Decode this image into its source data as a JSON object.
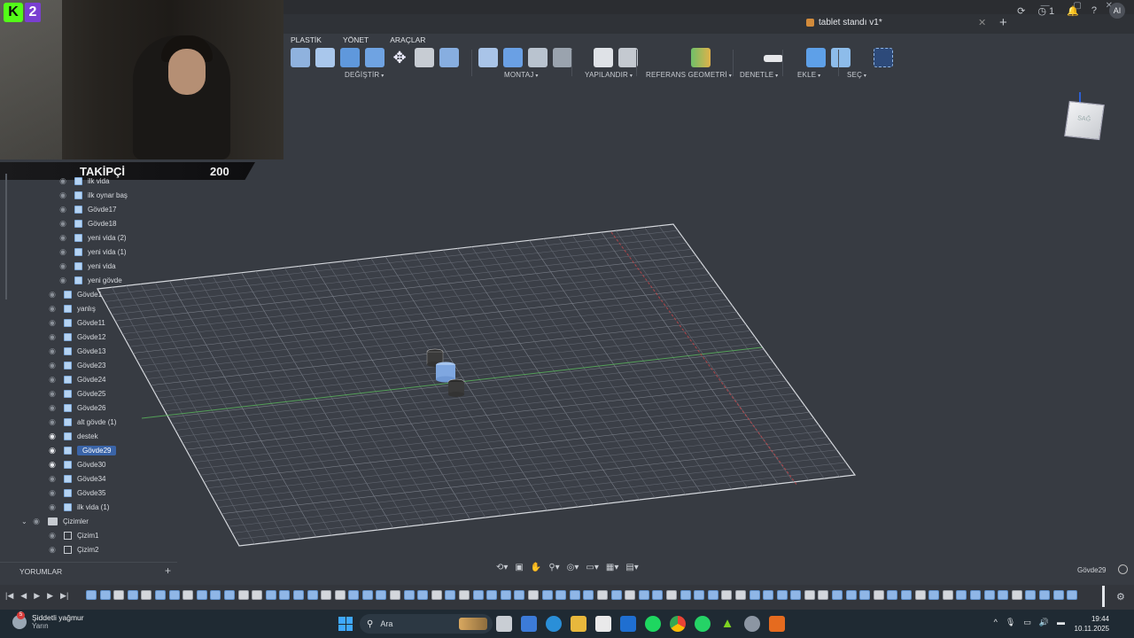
{
  "window": {
    "document_tab": "tablet standı v1*",
    "top_icons": [
      "+",
      "⟳",
      "⌚ 1",
      "🔔",
      "?",
      "AI"
    ]
  },
  "toolbar": {
    "tabs": [
      "PLASTİK",
      "YÖNET",
      "ARAÇLAR"
    ],
    "groups": {
      "modify": "DEĞİŞTİR",
      "assembly": "MONTAJ",
      "configure": "YAPILANDIR",
      "reference_geometry": "REFERANS GEOMETRİ",
      "inspect": "DENETLE",
      "insert": "EKLE",
      "select": "SEÇ"
    }
  },
  "stream": {
    "kick_number": "2",
    "followers_label": "TAKİPÇİ",
    "followers_count": "200"
  },
  "viewcube": {
    "face_label": "SAĞ"
  },
  "browser": {
    "items": [
      {
        "label": "ilk vida",
        "indent": 2,
        "visible": false,
        "kind": "body"
      },
      {
        "label": "ilk oynar baş",
        "indent": 2,
        "visible": false,
        "kind": "body"
      },
      {
        "label": "Gövde17",
        "indent": 2,
        "visible": false,
        "kind": "body"
      },
      {
        "label": "Gövde18",
        "indent": 2,
        "visible": false,
        "kind": "body"
      },
      {
        "label": "yeni vida (2)",
        "indent": 2,
        "visible": false,
        "kind": "body"
      },
      {
        "label": "yeni vida (1)",
        "indent": 2,
        "visible": false,
        "kind": "body"
      },
      {
        "label": "yeni vida",
        "indent": 2,
        "visible": false,
        "kind": "body"
      },
      {
        "label": "yeni gövde",
        "indent": 2,
        "visible": false,
        "kind": "body"
      },
      {
        "label": "Gövde1",
        "indent": 1,
        "visible": false,
        "kind": "body"
      },
      {
        "label": "yanlış",
        "indent": 1,
        "visible": false,
        "kind": "body"
      },
      {
        "label": "Gövde11",
        "indent": 1,
        "visible": false,
        "kind": "body"
      },
      {
        "label": "Gövde12",
        "indent": 1,
        "visible": false,
        "kind": "body"
      },
      {
        "label": "Gövde13",
        "indent": 1,
        "visible": false,
        "kind": "body"
      },
      {
        "label": "Gövde23",
        "indent": 1,
        "visible": false,
        "kind": "body"
      },
      {
        "label": "Gövde24",
        "indent": 1,
        "visible": false,
        "kind": "body"
      },
      {
        "label": "Gövde25",
        "indent": 1,
        "visible": false,
        "kind": "body"
      },
      {
        "label": "Gövde26",
        "indent": 1,
        "visible": false,
        "kind": "body"
      },
      {
        "label": "alt gövde (1)",
        "indent": 1,
        "visible": false,
        "kind": "body"
      },
      {
        "label": "destek",
        "indent": 1,
        "visible": true,
        "kind": "body"
      },
      {
        "label": "Gövde29",
        "indent": 1,
        "visible": true,
        "kind": "body",
        "selected": true
      },
      {
        "label": "Gövde30",
        "indent": 1,
        "visible": true,
        "kind": "body"
      },
      {
        "label": "Gövde34",
        "indent": 1,
        "visible": false,
        "kind": "body"
      },
      {
        "label": "Gövde35",
        "indent": 1,
        "visible": false,
        "kind": "body"
      },
      {
        "label": "ilk vida (1)",
        "indent": 1,
        "visible": false,
        "kind": "body"
      },
      {
        "label": "Çizimler",
        "indent": 0,
        "visible": false,
        "kind": "folder"
      },
      {
        "label": "Çizim1",
        "indent": 1,
        "visible": false,
        "kind": "sketch"
      },
      {
        "label": "Çizim2",
        "indent": 1,
        "visible": false,
        "kind": "sketch"
      }
    ]
  },
  "comments": {
    "label": "YORUMLAR",
    "add": "+"
  },
  "status": {
    "selected_body": "Gövde29"
  },
  "taskbar": {
    "weather_badge": "5",
    "weather_title": "Şiddetli yağmur",
    "weather_sub": "Yarın",
    "search_placeholder": "Ara",
    "time": "19:44",
    "date": "10.11.2025"
  },
  "colors": {
    "accent": "#3a64a8",
    "body_icon": "#b5d3f2",
    "kick_green": "#53fc18"
  }
}
